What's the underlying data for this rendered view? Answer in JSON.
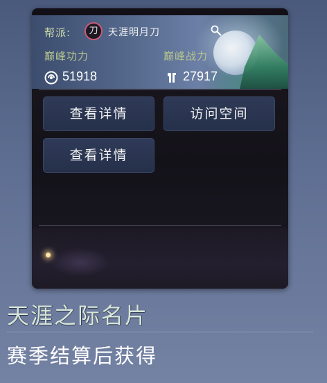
{
  "card": {
    "guild_label": "帮派:",
    "guild_badge_char": "刀",
    "guild_name": "天涯明月刀",
    "peak_gongli_label": "巅峰功力",
    "peak_zhanli_label": "巅峰战力",
    "gongli_value": "51918",
    "zhanli_value": "27917",
    "buttons": [
      "查看详情",
      "访问空间",
      "查看详情"
    ],
    "colors": {
      "badge_ring": "#c85a78",
      "label_text": "#c9d6a6",
      "button_bg": "#2f3a58"
    }
  },
  "footer": {
    "title": "天涯之际名片",
    "subtitle": "赛季结算后获得"
  }
}
